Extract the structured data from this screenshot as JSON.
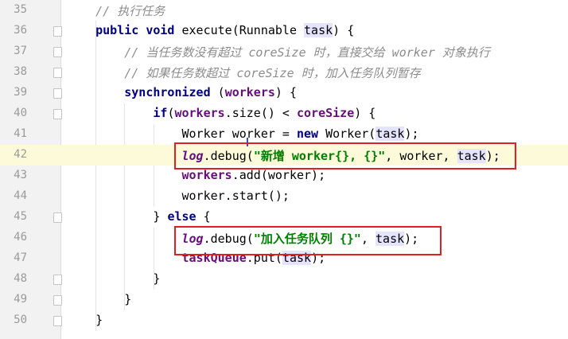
{
  "editor": {
    "lines": [
      {
        "num": "35",
        "code": "    // 执行任务"
      },
      {
        "num": "36",
        "code": "    public void execute(Runnable task) {"
      },
      {
        "num": "37",
        "code": "        // 当任务数没有超过 coreSize 时，直接交给 worker 对象执行"
      },
      {
        "num": "38",
        "code": "        // 如果任务数超过 coreSize 时，加入任务队列暂存"
      },
      {
        "num": "39",
        "code": "        synchronized (workers) {"
      },
      {
        "num": "40",
        "code": "            if(workers.size() < coreSize) {"
      },
      {
        "num": "41",
        "code": "                Worker worker = new Worker(task);"
      },
      {
        "num": "42",
        "code": "                log.debug(\"新增 worker{}, {}\", worker, task);"
      },
      {
        "num": "43",
        "code": "                workers.add(worker);"
      },
      {
        "num": "44",
        "code": "                worker.start();"
      },
      {
        "num": "45",
        "code": "            } else {"
      },
      {
        "num": "46",
        "code": "                log.debug(\"加入任务队列 {}\", task);"
      },
      {
        "num": "47",
        "code": "                taskQueue.put(task);"
      },
      {
        "num": "48",
        "code": "            }"
      },
      {
        "num": "49",
        "code": "        }"
      },
      {
        "num": "50",
        "code": "    }"
      }
    ],
    "current_line": "42",
    "highlighted_lines": [
      "42",
      "46"
    ],
    "highlight_color": "#e02020"
  }
}
